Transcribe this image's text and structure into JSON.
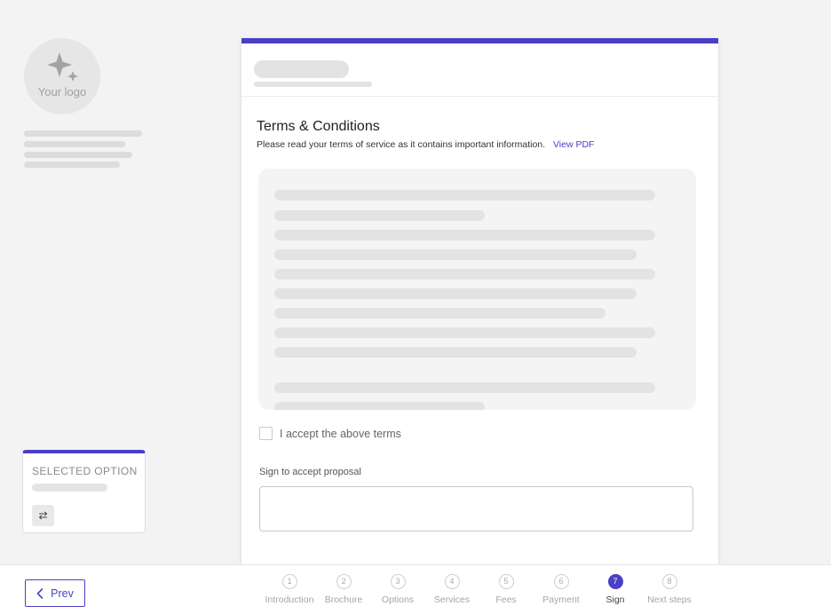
{
  "branding": {
    "logo_text": "Your logo"
  },
  "selected_option": {
    "title": "SELECTED OPTION",
    "swap_icon": "swap-arrows-icon"
  },
  "terms": {
    "title": "Terms & Conditions",
    "subtitle": "Please read your terms of service as it contains important information.",
    "view_pdf": "View PDF",
    "accept_label": "I accept the above terms",
    "accept_checked": false
  },
  "signature": {
    "label": "Sign to accept proposal",
    "value": ""
  },
  "footer": {
    "prev_label": "Prev"
  },
  "steps": [
    {
      "number": "1",
      "label": "Introduction"
    },
    {
      "number": "2",
      "label": "Brochure"
    },
    {
      "number": "3",
      "label": "Options"
    },
    {
      "number": "4",
      "label": "Services"
    },
    {
      "number": "5",
      "label": "Fees"
    },
    {
      "number": "6",
      "label": "Payment"
    },
    {
      "number": "7",
      "label": "Sign"
    },
    {
      "number": "8",
      "label": "Next steps"
    }
  ],
  "current_step": "7",
  "colors": {
    "accent": "#4a40c4",
    "background": "#f3f3f3"
  }
}
